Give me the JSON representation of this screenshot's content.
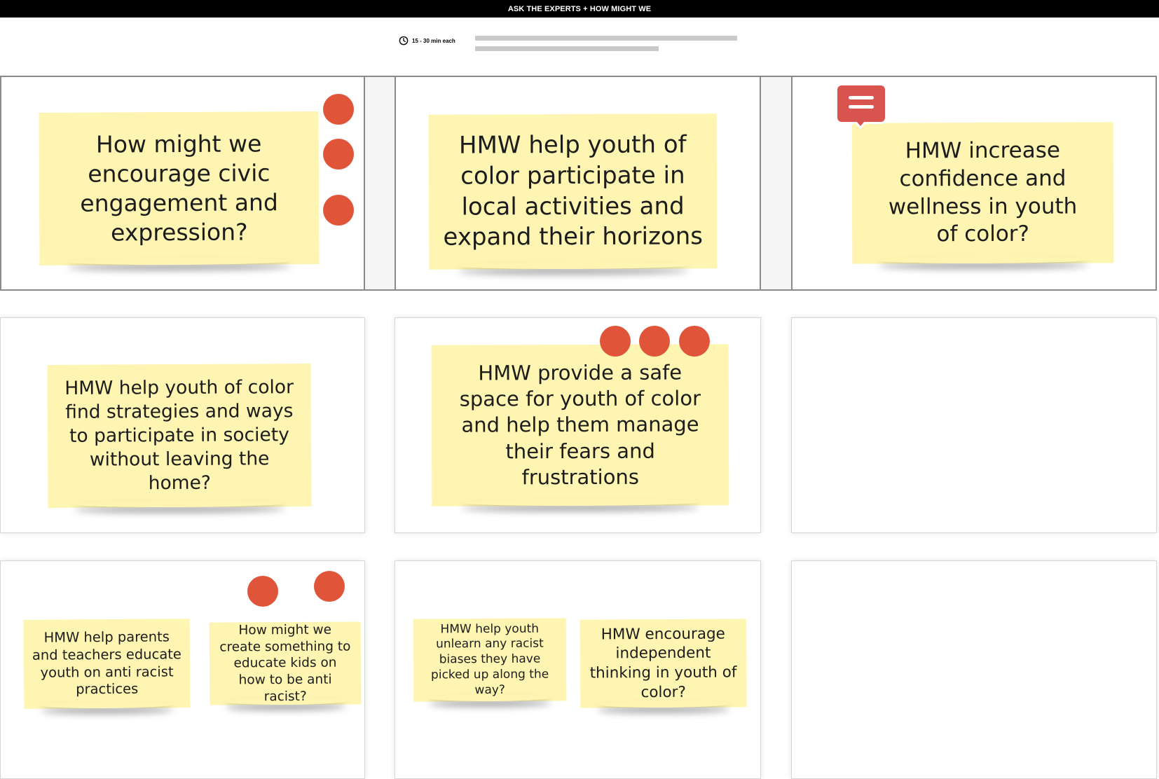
{
  "header": {
    "title": "ASK THE EXPERTS + HOW MIGHT WE"
  },
  "timer": {
    "label": "15 - 30 min each",
    "icon": "clock-icon"
  },
  "colors": {
    "sticky": "#fdf5b1",
    "dot": "#e05539",
    "comment": "#d9534f"
  },
  "stickies": [
    {
      "text": "How might we encourage civic engagement and expression?"
    },
    {
      "text": "HMW help youth of color participate in local activities and expand their horizons"
    },
    {
      "text": "HMW increase confidence and wellness in youth of color?"
    },
    {
      "text": "HMW help youth of color find strategies and ways to participate in society without leaving the home?"
    },
    {
      "text": "HMW provide a safe space for youth of color and help them manage their fears and frustrations"
    },
    {
      "text": "HMW help parents and teachers educate youth on anti racist practices"
    },
    {
      "text": "How might we create something to educate kids on how to be anti racist?"
    },
    {
      "text": "HMW help youth unlearn any racist biases they have picked up along the way?"
    },
    {
      "text": "HMW encourage independent thinking in youth of color?"
    }
  ]
}
